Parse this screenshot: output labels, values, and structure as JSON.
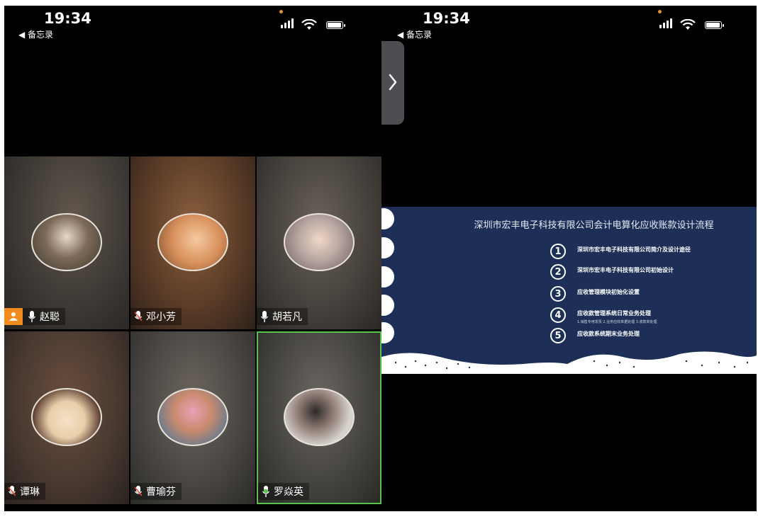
{
  "left_screen": {
    "status": {
      "time": "19:34",
      "back_label": "◀ 备忘录"
    },
    "participants": [
      {
        "name": "赵聪",
        "host": true,
        "mic": "on"
      },
      {
        "name": "邓小芳",
        "host": false,
        "mic": "muted"
      },
      {
        "name": "胡若凡",
        "host": false,
        "mic": "on"
      },
      {
        "name": "谭琳",
        "host": false,
        "mic": "muted"
      },
      {
        "name": "曹瑜芬",
        "host": false,
        "mic": "muted"
      },
      {
        "name": "罗焱英",
        "host": false,
        "mic": "speaking",
        "active": true
      }
    ]
  },
  "right_screen": {
    "status": {
      "time": "19:34",
      "back_label": "◀ 备忘录"
    },
    "slide": {
      "title": "深圳市宏丰电子科技有限公司会计电算化应收账款设计流程",
      "steps": [
        {
          "num": "1",
          "label": "深圳市宏丰电子科技有限公司简介及设计途径",
          "sub": ""
        },
        {
          "num": "2",
          "label": "深圳市宏丰电子科技有限公司初始设计",
          "sub": ""
        },
        {
          "num": "3",
          "label": "应收管理模块初始化设置",
          "sub": ""
        },
        {
          "num": "4",
          "label": "应收款管理系统日常业务处理",
          "sub": "1.销售专用发票    2.业务应收单据处理    3.收款单处理"
        },
        {
          "num": "5",
          "label": "应收款系统期末业务处理",
          "sub": ""
        }
      ]
    }
  },
  "colors": {
    "host_badge": "#f28b1d",
    "speaking_border": "#57c24c",
    "slide_bg": "#1d2f57"
  }
}
